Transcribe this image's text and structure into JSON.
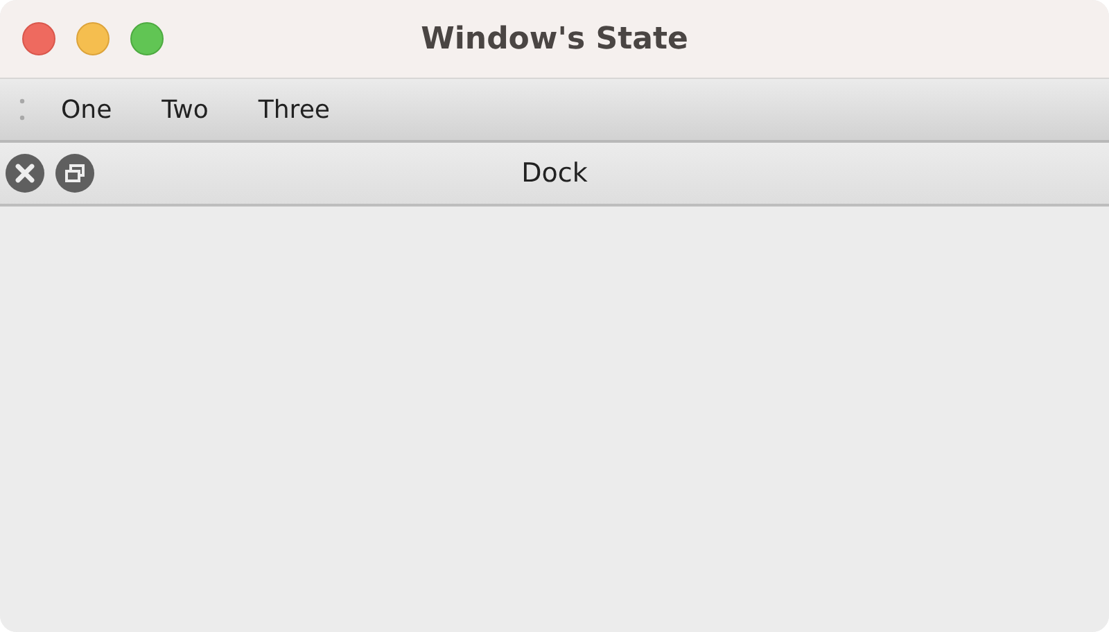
{
  "window": {
    "title": "Window's State"
  },
  "toolbar": {
    "items": [
      {
        "label": "One"
      },
      {
        "label": "Two"
      },
      {
        "label": "Three"
      }
    ]
  },
  "dock": {
    "title": "Dock"
  }
}
